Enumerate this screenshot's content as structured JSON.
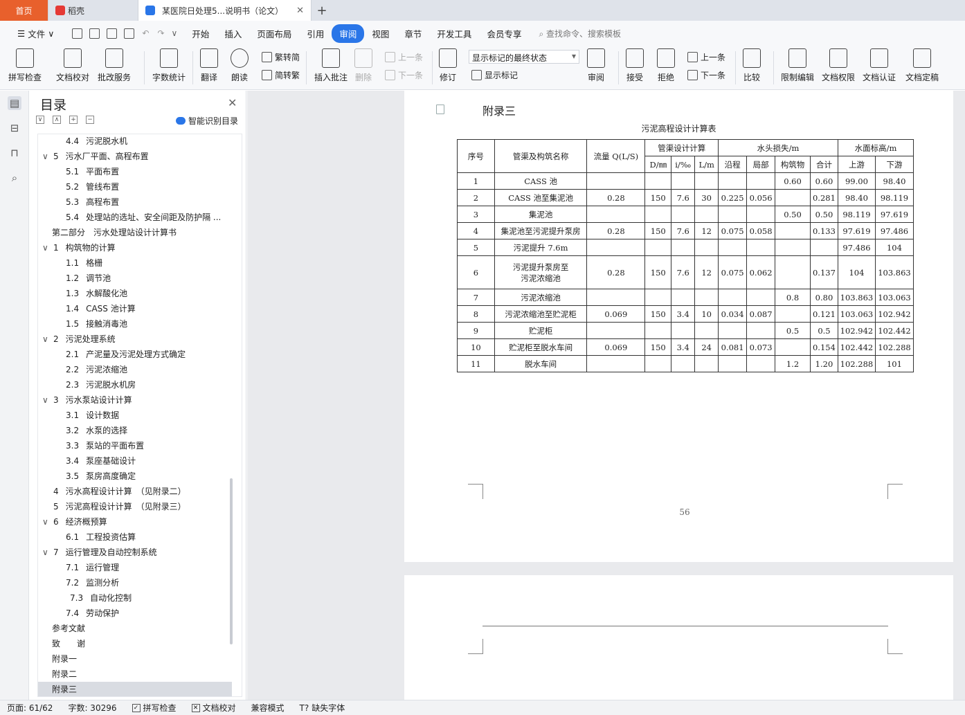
{
  "tabs": {
    "home": "首页",
    "wps": "稻壳",
    "doc": "某医院日处理5...说明书（论文）"
  },
  "menu": {
    "file": "文件",
    "items": [
      "开始",
      "插入",
      "页面布局",
      "引用",
      "审阅",
      "视图",
      "章节",
      "开发工具",
      "会员专享"
    ],
    "active": "审阅",
    "search": "查找命令、搜索模板"
  },
  "ribbon": {
    "spellcheck": "拼写检查",
    "doc_proof": "文档校对",
    "batch_service": "批改服务",
    "word_count": "字数统计",
    "translate": "翻译",
    "read_aloud": "朗读",
    "trad_to_simp": "繁转简",
    "simp_to_trad": "简转繁",
    "insert_comment": "插入批注",
    "delete": "删除",
    "prev": "上一条",
    "next": "下一条",
    "track": "修订",
    "markup_state": "显示标记的最终状态",
    "show_markup": "显示标记",
    "review": "审阅",
    "accept": "接受",
    "reject": "拒绝",
    "prev2": "上一条",
    "next2": "下一条",
    "compare": "比较",
    "restrict": "限制编辑",
    "permission": "文档权限",
    "certify": "文档认证",
    "finalize": "文档定稿"
  },
  "toc": {
    "title": "目录",
    "smart": "智能识别目录",
    "items": [
      {
        "num": "4.4",
        "text": "污泥脱水机",
        "level": 2
      },
      {
        "num": "5",
        "text": "污水厂平面、高程布置",
        "level": 1,
        "chev": "∨"
      },
      {
        "num": "5.1",
        "text": "平面布置",
        "level": 2
      },
      {
        "num": "5.2",
        "text": "管线布置",
        "level": 2
      },
      {
        "num": "5.3",
        "text": "高程布置",
        "level": 2
      },
      {
        "num": "5.4",
        "text": "处理站的选址、安全间距及防护隔 ...",
        "level": 2
      },
      {
        "num": "",
        "text": "第二部分　污水处理站设计计算书",
        "level": 0
      },
      {
        "num": "1",
        "text": "构筑物的计算",
        "level": 1,
        "chev": "∨"
      },
      {
        "num": "1.1",
        "text": "格栅",
        "level": 2
      },
      {
        "num": "1.2",
        "text": "调节池",
        "level": 2
      },
      {
        "num": "1.3",
        "text": "水解酸化池",
        "level": 2
      },
      {
        "num": "1.4",
        "text": "CASS 池计算",
        "level": 2
      },
      {
        "num": "1.5",
        "text": "接触消毒池",
        "level": 2
      },
      {
        "num": "2",
        "text": "污泥处理系统",
        "level": 1,
        "chev": "∨"
      },
      {
        "num": "2.1",
        "text": "产泥量及污泥处理方式确定",
        "level": 2
      },
      {
        "num": "2.2",
        "text": "污泥浓缩池",
        "level": 2
      },
      {
        "num": "2.3",
        "text": "污泥脱水机房",
        "level": 2
      },
      {
        "num": "3",
        "text": "污水泵站设计计算",
        "level": 1,
        "chev": "∨"
      },
      {
        "num": "3.1",
        "text": "设计数据",
        "level": 2
      },
      {
        "num": "3.2",
        "text": "水泵的选择",
        "level": 2
      },
      {
        "num": "3.3",
        "text": "泵站的平面布置",
        "level": 2
      },
      {
        "num": "3.4",
        "text": "泵座基础设计",
        "level": 2
      },
      {
        "num": "3.5",
        "text": "泵房高度确定",
        "level": 2
      },
      {
        "num": "4",
        "text": "污水高程设计计算　（见附录二）",
        "level": 1
      },
      {
        "num": "5",
        "text": "污泥高程设计计算　（见附录三）",
        "level": 1
      },
      {
        "num": "6",
        "text": "经济概预算",
        "level": 1,
        "chev": "∨"
      },
      {
        "num": "6.1",
        "text": "工程投资估算",
        "level": 2
      },
      {
        "num": "7",
        "text": "运行管理及自动控制系统",
        "level": 1,
        "chev": "∨"
      },
      {
        "num": "7.1",
        "text": "运行管理",
        "level": 2
      },
      {
        "num": "7.2",
        "text": "监测分析",
        "level": 2
      },
      {
        "num": "7.3",
        "text": "自动化控制",
        "level": 3
      },
      {
        "num": "7.4",
        "text": "劳动保护",
        "level": 2
      },
      {
        "num": "",
        "text": "参考文献",
        "level": 0
      },
      {
        "num": "",
        "text": "致　　谢",
        "level": 0
      },
      {
        "num": "",
        "text": "附录一",
        "level": 0
      },
      {
        "num": "",
        "text": "附录二",
        "level": 0
      },
      {
        "num": "",
        "text": "附录三",
        "level": 0,
        "selected": true
      }
    ]
  },
  "document": {
    "heading": "附录三",
    "table_title": "污泥高程设计计算表",
    "headers": {
      "no": "序号",
      "name": "管渠及构筑名称",
      "flow": "流量 Q(L/S)",
      "design": "管渠设计计算",
      "d": "D/㎜",
      "i": "i/‰",
      "l": "L/m",
      "loss": "水头损失/m",
      "along": "沿程",
      "local": "局部",
      "struct": "构筑物",
      "total": "合计",
      "level": "水面标高/m",
      "up": "上游",
      "down": "下游"
    },
    "rows": [
      [
        "1",
        "CASS 池",
        "",
        "",
        "",
        "",
        "",
        "",
        "0.60",
        "0.60",
        "99.00",
        "98.40"
      ],
      [
        "2",
        "CASS 池至集泥池",
        "0.28",
        "150",
        "7.6",
        "30",
        "0.225",
        "0.056",
        "",
        "0.281",
        "98.40",
        "98.119"
      ],
      [
        "3",
        "集泥池",
        "",
        "",
        "",
        "",
        "",
        "",
        "0.50",
        "0.50",
        "98.119",
        "97.619"
      ],
      [
        "4",
        "集泥池至污泥提升泵房",
        "0.28",
        "150",
        "7.6",
        "12",
        "0.075",
        "0.058",
        "",
        "0.133",
        "97.619",
        "97.486"
      ],
      [
        "5",
        "污泥提升 7.6m",
        "",
        "",
        "",
        "",
        "",
        "",
        "",
        "",
        "97.486",
        "104"
      ],
      [
        "6",
        "污泥提升泵房至\n污泥浓缩池",
        "0.28",
        "150",
        "7.6",
        "12",
        "0.075",
        "0.062",
        "",
        "0.137",
        "104",
        "103.863"
      ],
      [
        "7",
        "污泥浓缩池",
        "",
        "",
        "",
        "",
        "",
        "",
        "0.8",
        "0.80",
        "103.863",
        "103.063"
      ],
      [
        "8",
        "污泥浓缩池至贮泥柜",
        "0.069",
        "150",
        "3.4",
        "10",
        "0.034",
        "0.087",
        "",
        "0.121",
        "103.063",
        "102.942"
      ],
      [
        "9",
        "贮泥柜",
        "",
        "",
        "",
        "",
        "",
        "",
        "0.5",
        "0.5",
        "102.942",
        "102.442"
      ],
      [
        "10",
        "贮泥柜至脱水车间",
        "0.069",
        "150",
        "3.4",
        "24",
        "0.081",
        "0.073",
        "",
        "0.154",
        "102.442",
        "102.288"
      ],
      [
        "11",
        "脱水车间",
        "",
        "",
        "",
        "",
        "",
        "",
        "1.2",
        "1.20",
        "102.288",
        "101"
      ]
    ],
    "page_number": "56"
  },
  "status": {
    "page": "页面: 61/62",
    "words": "字数: 30296",
    "spellcheck": "拼写检查",
    "doc_proof": "文档校对",
    "compat": "兼容模式",
    "missing_font": "缺失字体"
  }
}
